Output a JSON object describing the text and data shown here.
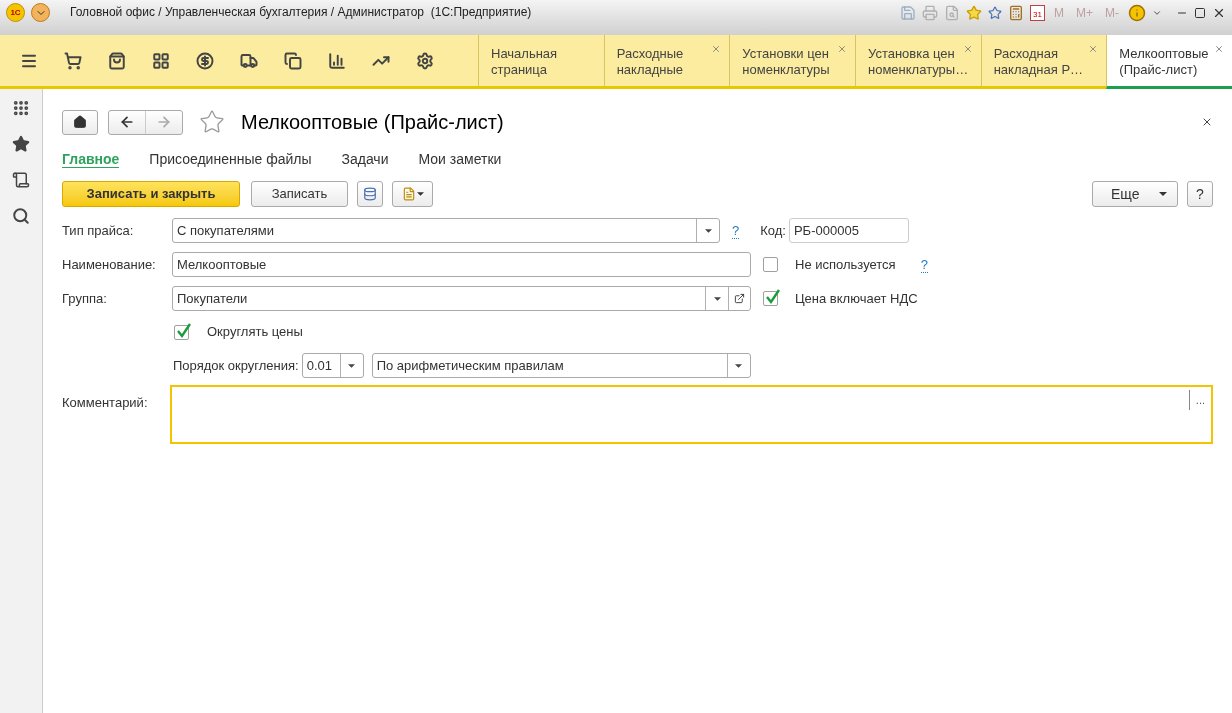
{
  "window": {
    "logo": "1С",
    "title": "Головной офис / Управленческая бухгалтерия / Администратор  (1С:Предприятие)",
    "memory_buttons": [
      "M",
      "M+",
      "M-"
    ],
    "calendar_day": "31"
  },
  "open_tabs": [
    {
      "lines": [
        "Начальная",
        "страница"
      ],
      "closable": false,
      "selected": false
    },
    {
      "lines": [
        "Расходные",
        "накладные"
      ],
      "closable": true,
      "selected": false
    },
    {
      "lines": [
        "Установки цен",
        "номенклатуры"
      ],
      "closable": true,
      "selected": false
    },
    {
      "lines": [
        "Установка цен",
        "номенклатуры…"
      ],
      "closable": true,
      "selected": false
    },
    {
      "lines": [
        "Расходная",
        "накладная Р…"
      ],
      "closable": true,
      "selected": false
    },
    {
      "lines": [
        "Мелкооптовые",
        "(Прайс-лист)"
      ],
      "closable": true,
      "selected": true
    }
  ],
  "form": {
    "title": "Мелкооптовые (Прайс-лист)",
    "favorite": false,
    "nav_tabs": [
      {
        "label": "Главное",
        "selected": true
      },
      {
        "label": "Присоединенные файлы",
        "selected": false
      },
      {
        "label": "Задачи",
        "selected": false
      },
      {
        "label": "Мои заметки",
        "selected": false
      }
    ],
    "primary_button": "Записать и закрыть",
    "save_button": "Записать",
    "more_button": "Еще",
    "help_button": "?",
    "price_type": {
      "label": "Тип прайса:",
      "value": "С покупателями",
      "hint": "?"
    },
    "code": {
      "label": "Код:",
      "value": "РБ-000005"
    },
    "name": {
      "label": "Наименование:",
      "value": "Мелкооптовые"
    },
    "not_used": {
      "label": "Не используется",
      "checked": false,
      "hint": "?"
    },
    "group": {
      "label": "Группа:",
      "value": "Покупатели"
    },
    "vat_included": {
      "label": "Цена включает НДС",
      "checked": true
    },
    "round_prices": {
      "label": "Округлять цены",
      "checked": true
    },
    "rounding": {
      "label": "Порядок округления:",
      "value": "0.01",
      "method": "По арифметическим правилам"
    },
    "comment": {
      "label": "Комментарий:",
      "button": "..."
    }
  }
}
